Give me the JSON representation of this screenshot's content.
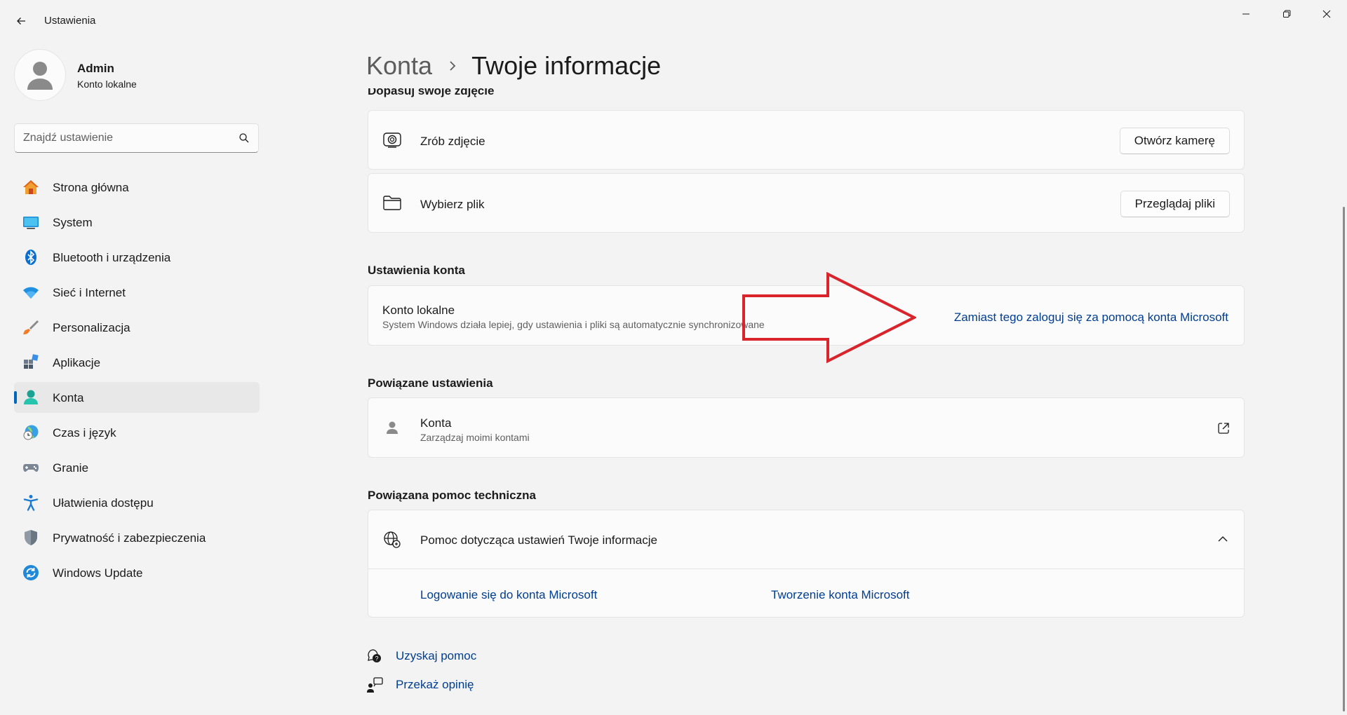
{
  "window": {
    "title": "Ustawienia"
  },
  "profile": {
    "name": "Admin",
    "account_type": "Konto lokalne"
  },
  "search": {
    "placeholder": "Znajdź ustawienie"
  },
  "nav": {
    "items": [
      {
        "label": "Strona główna",
        "icon": "home-icon"
      },
      {
        "label": "System",
        "icon": "system-icon"
      },
      {
        "label": "Bluetooth i urządzenia",
        "icon": "bluetooth-icon"
      },
      {
        "label": "Sieć i Internet",
        "icon": "wifi-icon"
      },
      {
        "label": "Personalizacja",
        "icon": "brush-icon"
      },
      {
        "label": "Aplikacje",
        "icon": "apps-icon"
      },
      {
        "label": "Konta",
        "icon": "accounts-icon",
        "active": true
      },
      {
        "label": "Czas i język",
        "icon": "time-language-icon"
      },
      {
        "label": "Granie",
        "icon": "gamepad-icon"
      },
      {
        "label": "Ułatwienia dostępu",
        "icon": "accessibility-icon"
      },
      {
        "label": "Prywatność i zabezpieczenia",
        "icon": "shield-icon"
      },
      {
        "label": "Windows Update",
        "icon": "update-icon"
      }
    ]
  },
  "breadcrumb": {
    "parent": "Konta",
    "current": "Twoje informacje"
  },
  "photo_section": {
    "title": "Dopasuj swoje zdjęcie",
    "camera": {
      "label": "Zrób zdjęcie",
      "button": "Otwórz kamerę"
    },
    "file": {
      "label": "Wybierz plik",
      "button": "Przeglądaj pliki"
    }
  },
  "account_settings": {
    "title": "Ustawienia konta",
    "card_title": "Konto lokalne",
    "card_sub": "System Windows działa lepiej, gdy ustawienia i pliki są automatycznie synchronizowane",
    "link": "Zamiast tego zaloguj się za pomocą konta Microsoft"
  },
  "related_settings": {
    "title": "Powiązane ustawienia",
    "card_title": "Konta",
    "card_sub": "Zarządzaj moimi kontami"
  },
  "related_support": {
    "title": "Powiązana pomoc techniczna",
    "card_title": "Pomoc dotycząca ustawień Twoje informacje",
    "link1": "Logowanie się do konta Microsoft",
    "link2": "Tworzenie konta Microsoft"
  },
  "footer": {
    "help": "Uzyskaj pomoc",
    "feedback": "Przekaż opinię"
  },
  "colors": {
    "accent": "#0067c0",
    "link": "#003e92",
    "annotation_arrow": "#d9242b"
  }
}
